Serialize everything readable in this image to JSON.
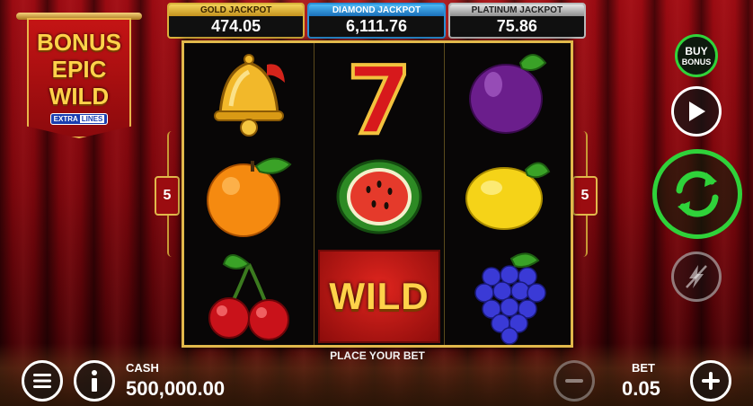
{
  "logo": {
    "line1": "BONUS",
    "line2": "EPIC",
    "line3": "WILD",
    "badge_left": "EXTRA",
    "badge_right": "LINES"
  },
  "jackpots": [
    {
      "title": "GOLD JACKPOT",
      "value": "474.05"
    },
    {
      "title": "DIAMOND JACKPOT",
      "value": "6,111.76"
    },
    {
      "title": "PLATINUM JACKPOT",
      "value": "75.86"
    }
  ],
  "reels": {
    "col1": [
      "bell",
      "orange",
      "cherry"
    ],
    "col2": [
      "seven",
      "watermelon",
      "wild"
    ],
    "col3": [
      "plum",
      "lemon",
      "grapes"
    ],
    "wild_label": "WILD",
    "seven_label": "7"
  },
  "lines": {
    "left": "5",
    "right": "5"
  },
  "status": "PLACE YOUR BET",
  "buy_bonus": {
    "line1": "BUY",
    "line2": "BONUS"
  },
  "cash": {
    "label": "CASH",
    "value": "500,000.00"
  },
  "bet": {
    "label": "BET",
    "value": "0.05"
  },
  "icons": {
    "menu": "menu-icon",
    "info": "info-icon",
    "minus": "minus-icon",
    "plus": "plus-icon",
    "autoplay": "play-icon",
    "spin": "refresh-icon",
    "turbo": "lightning-off-icon"
  },
  "colors": {
    "spin_green": "#2fd23a",
    "frame_gold": "#e1b84b",
    "curtain_red": "#9a0b12"
  }
}
